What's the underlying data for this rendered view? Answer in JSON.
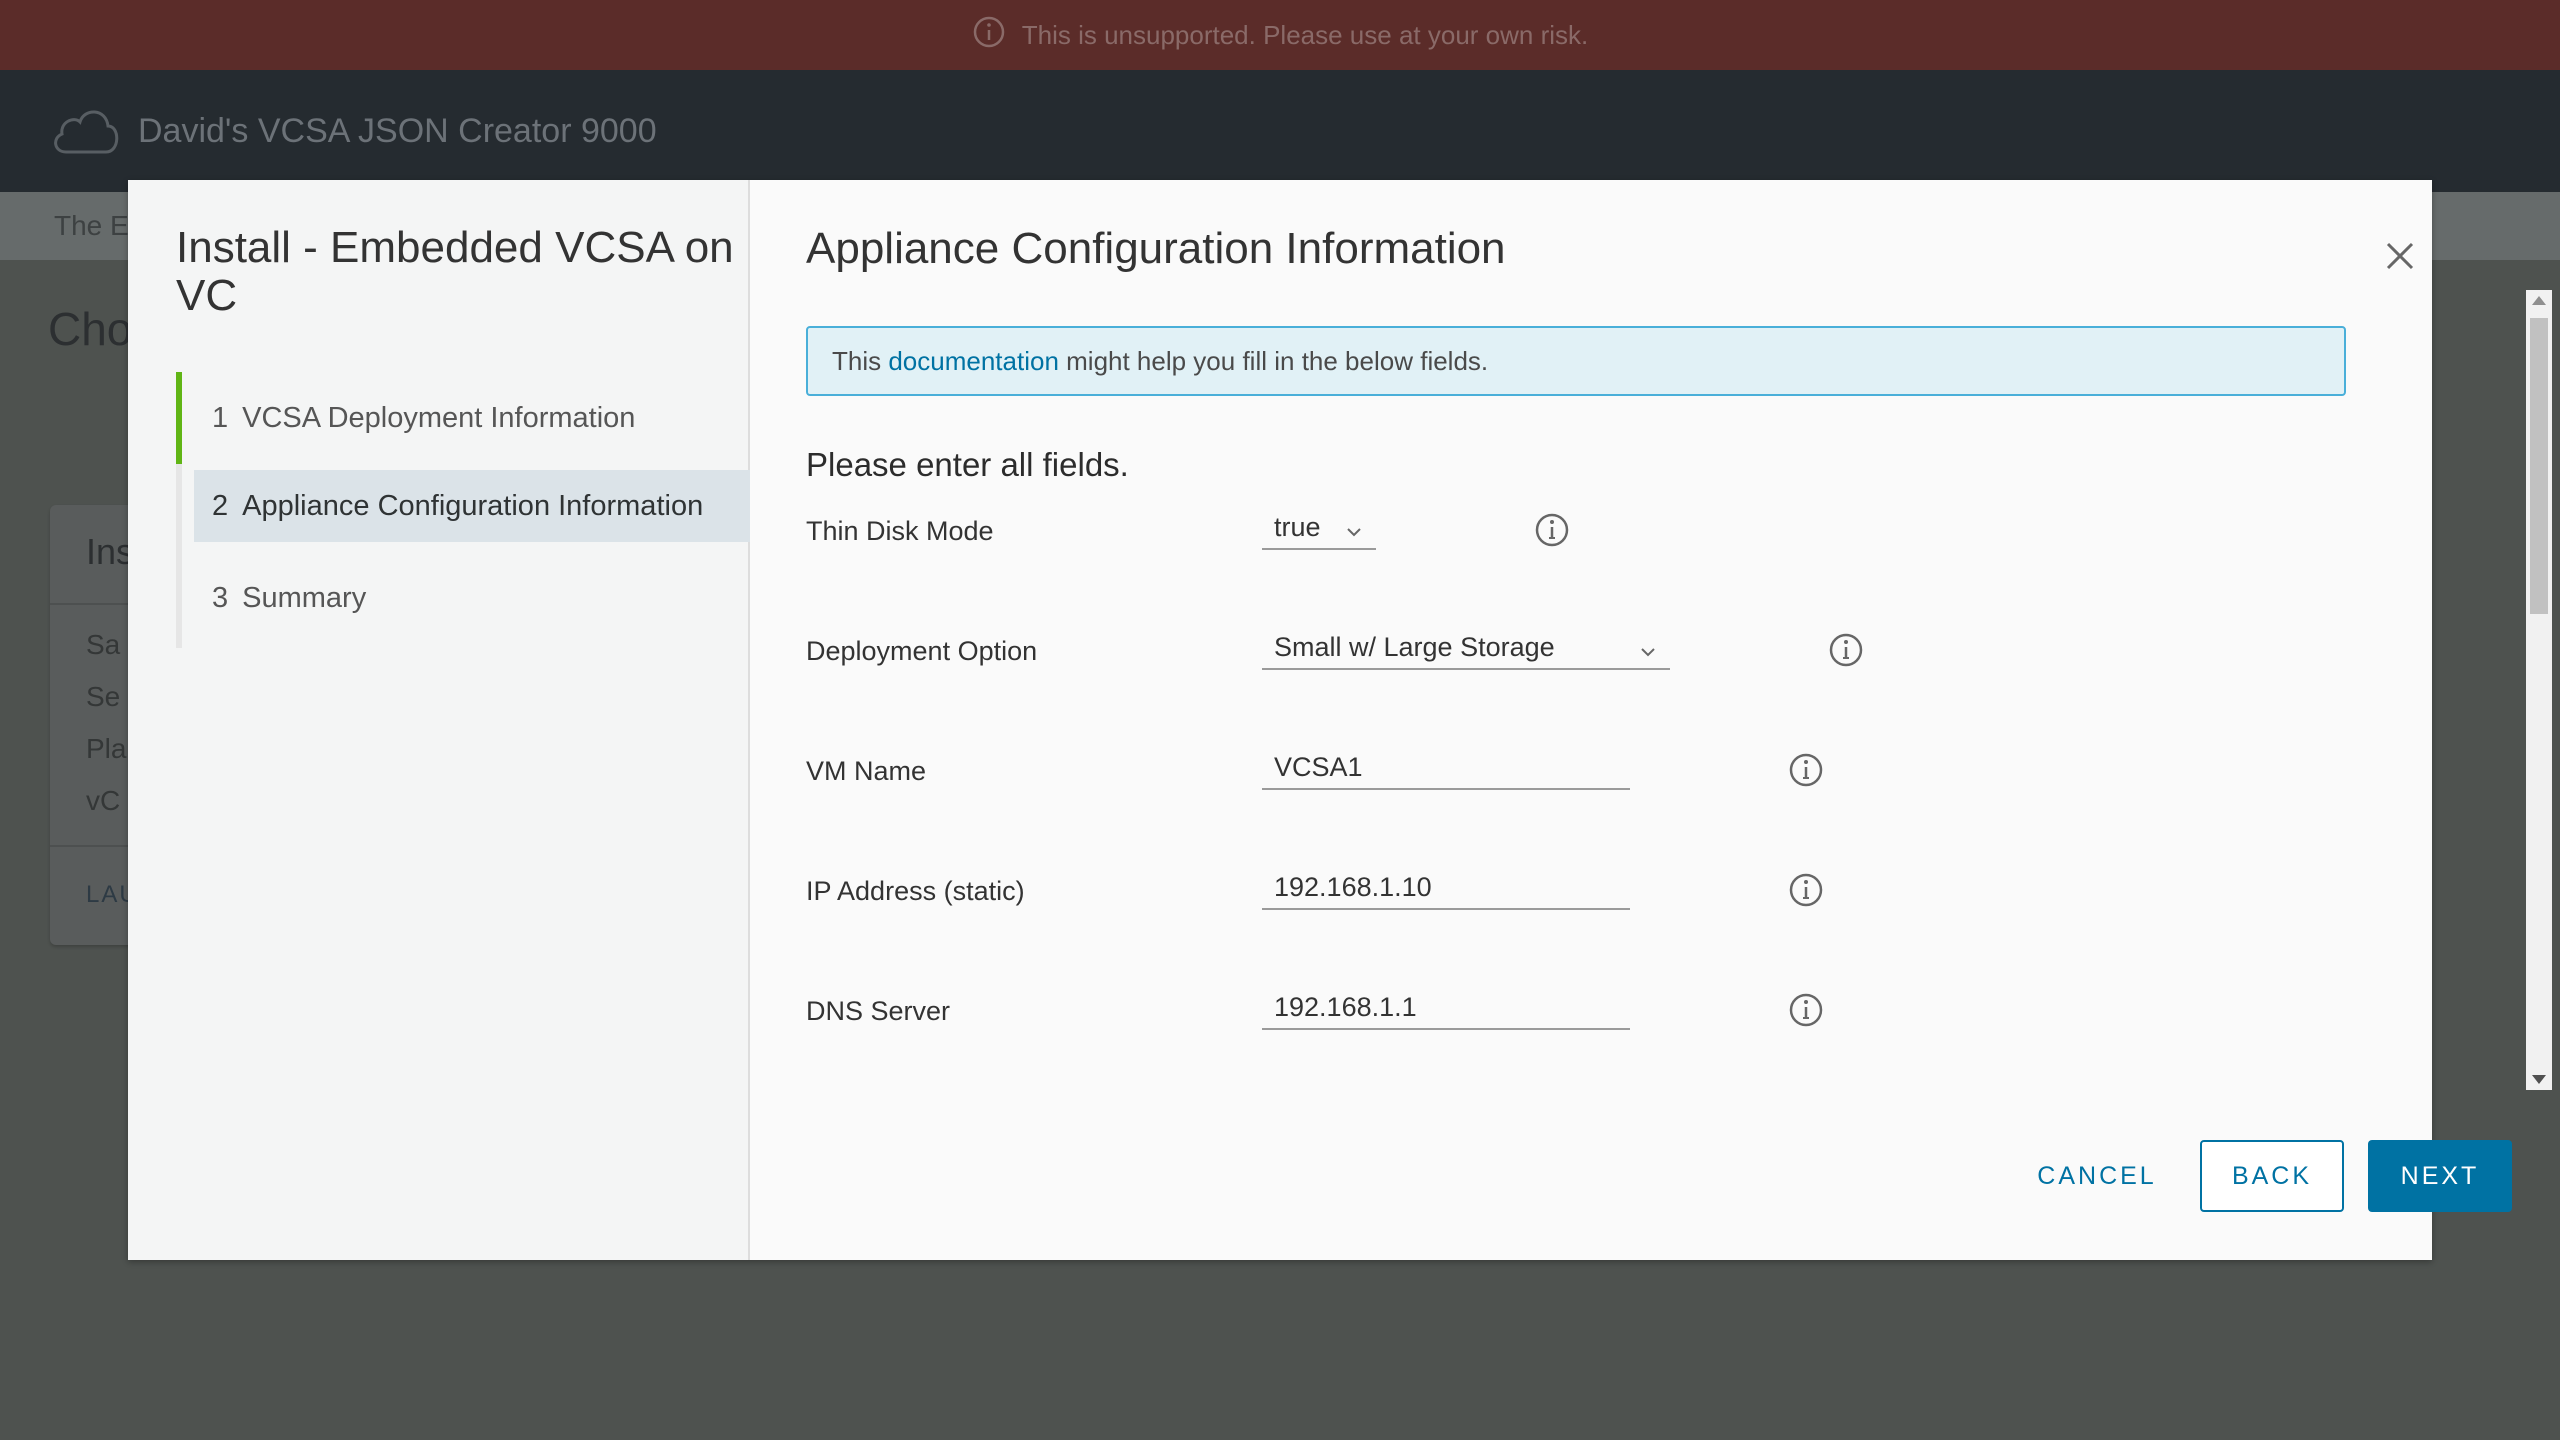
{
  "banner": {
    "text": "This is unsupported. Please use at your own risk."
  },
  "app": {
    "title": "David's VCSA JSON Creator 9000",
    "subnav_text": "The E",
    "page_title": "Cho",
    "card": {
      "title": "Ins",
      "rows": [
        "Sa",
        "Se",
        "Pla",
        "vC"
      ],
      "link": "LAU"
    }
  },
  "wizard": {
    "title": "Install - Embedded VCSA on VC",
    "steps": [
      {
        "num": "1",
        "label": "VCSA Deployment Information",
        "state": "completed"
      },
      {
        "num": "2",
        "label": "Appliance Configuration Information",
        "state": "active"
      },
      {
        "num": "3",
        "label": "Summary",
        "state": "pending"
      }
    ]
  },
  "page": {
    "title": "Appliance Configuration Information",
    "alert": {
      "prefix": "This ",
      "link": "documentation",
      "suffix": " might help you fill in the below fields."
    },
    "intro": "Please enter all fields.",
    "fields": [
      {
        "label": "Thin Disk Mode",
        "value": "true",
        "type": "select"
      },
      {
        "label": "Deployment Option",
        "value": "Small w/ Large Storage",
        "type": "select"
      },
      {
        "label": "VM Name",
        "value": "VCSA1",
        "type": "text"
      },
      {
        "label": "IP Address (static)",
        "value": "192.168.1.10",
        "type": "text"
      },
      {
        "label": "DNS Server",
        "value": "192.168.1.1",
        "type": "text"
      }
    ]
  },
  "buttons": {
    "cancel": "CANCEL",
    "back": "BACK",
    "next": "NEXT"
  },
  "colors": {
    "accent": "#0072a3",
    "step_done": "#60b515",
    "alert_border": "#49afd9",
    "banner_bg": "#5b2c29"
  },
  "icons": [
    "info-circle-icon",
    "cloud-logo-icon",
    "close-icon",
    "chevron-down-icon"
  ]
}
